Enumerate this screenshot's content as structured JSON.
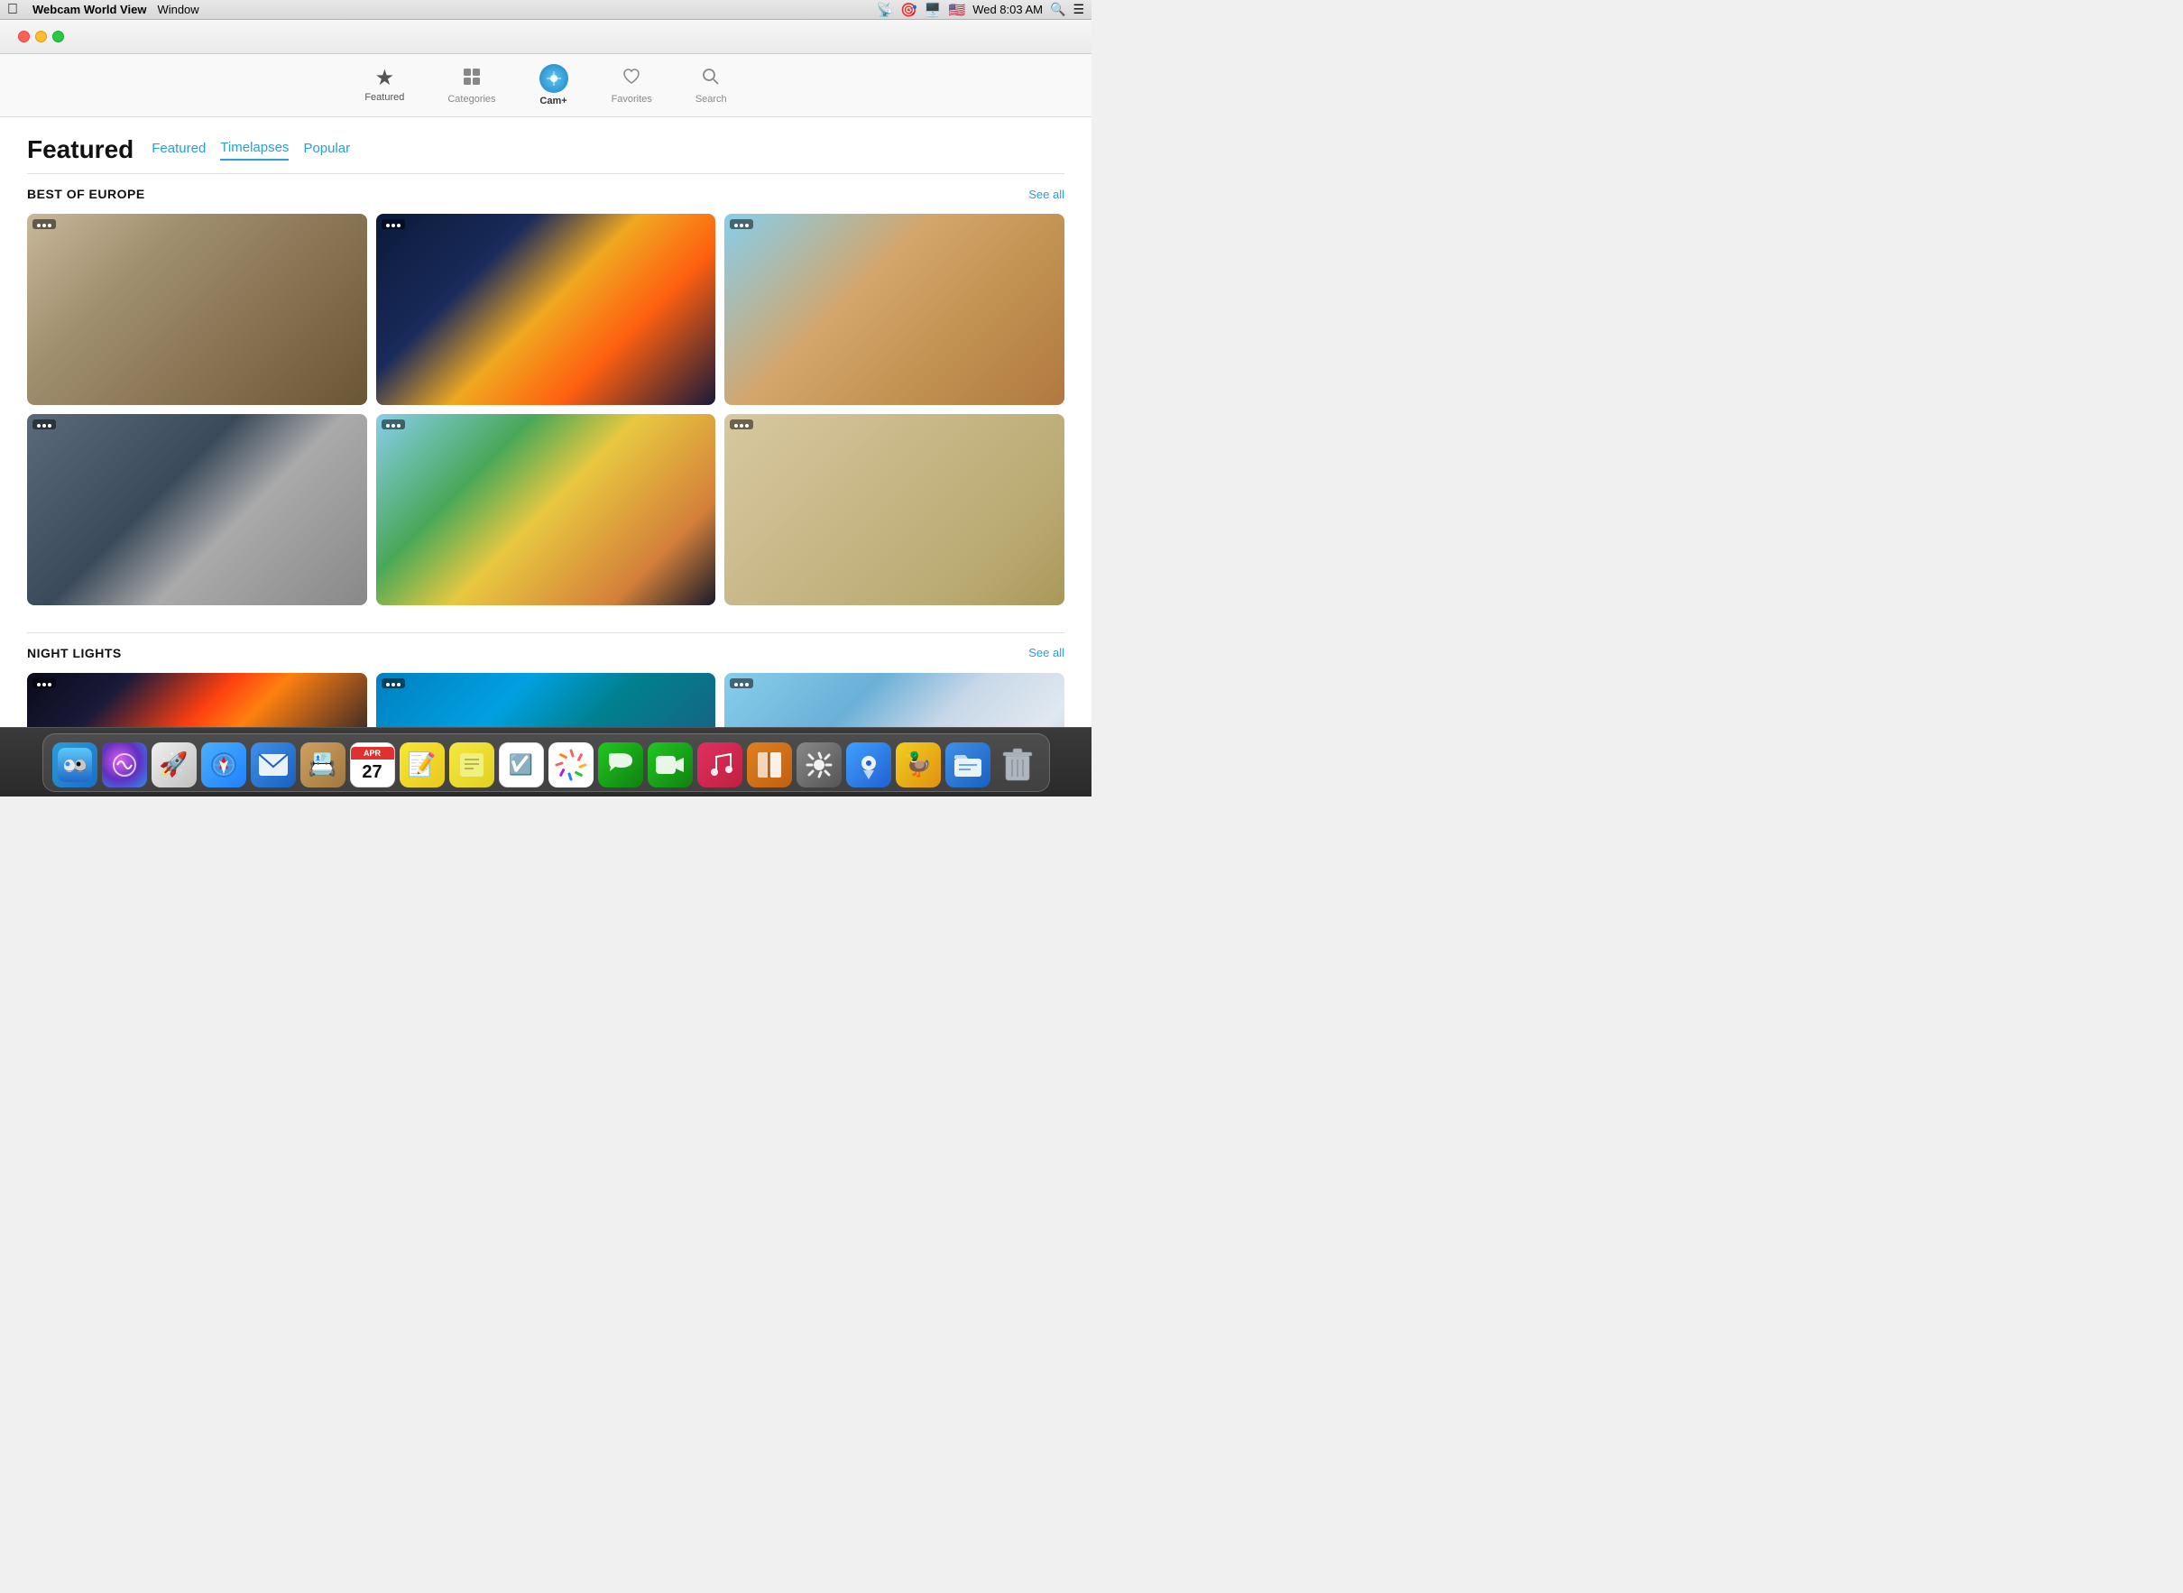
{
  "menubar": {
    "apple": "⌘",
    "app_name": "Webcam World View",
    "menu_window": "Window",
    "time": "Wed 8:03 AM"
  },
  "toolbar": {
    "items": [
      {
        "id": "featured",
        "label": "Featured",
        "icon": "★",
        "active": false
      },
      {
        "id": "categories",
        "label": "Categories",
        "icon": "⊞",
        "active": false
      },
      {
        "id": "cam_plus",
        "label": "Cam+",
        "icon": "📷",
        "active": true
      },
      {
        "id": "favorites",
        "label": "Favorites",
        "icon": "♡",
        "active": false
      },
      {
        "id": "search",
        "label": "Search",
        "icon": "🔍",
        "active": false
      }
    ]
  },
  "page": {
    "title": "Featured",
    "tabs": [
      {
        "id": "featured",
        "label": "Featured",
        "selected": false
      },
      {
        "id": "timelapses",
        "label": "Timelapses",
        "selected": true
      },
      {
        "id": "popular",
        "label": "Popular",
        "selected": false
      }
    ]
  },
  "sections": [
    {
      "id": "best_of_europe",
      "title": "BEST OF EUROPE",
      "see_all": "See all",
      "items": [
        {
          "id": "athens",
          "class": "img-athens"
        },
        {
          "id": "stpete_night",
          "class": "img-stpete-night"
        },
        {
          "id": "rome",
          "class": "img-rome"
        },
        {
          "id": "harbor",
          "class": "img-harbor"
        },
        {
          "id": "church",
          "class": "img-church"
        },
        {
          "id": "aerial",
          "class": "img-aerial"
        }
      ]
    },
    {
      "id": "night_lights",
      "title": "NIGHT LIGHTS",
      "see_all": "See all",
      "items": [
        {
          "id": "nyc",
          "class": "img-nyc"
        },
        {
          "id": "dubai",
          "class": "img-dubai"
        },
        {
          "id": "barcelona",
          "class": "img-barcelona"
        }
      ]
    }
  ],
  "dock": {
    "items": [
      {
        "id": "finder",
        "label": "Finder",
        "class": "finder",
        "icon": "🔵"
      },
      {
        "id": "siri",
        "label": "Siri",
        "class": "siri",
        "icon": "🎤"
      },
      {
        "id": "rocket",
        "label": "Rocket Typist",
        "class": "rocket",
        "icon": "🚀"
      },
      {
        "id": "safari",
        "label": "Safari",
        "class": "safari",
        "icon": "🧭"
      },
      {
        "id": "mail",
        "label": "Mail",
        "class": "mail",
        "icon": "✉️"
      },
      {
        "id": "contacts",
        "label": "Contacts",
        "class": "contacts",
        "icon": "👤"
      },
      {
        "id": "calendar",
        "label": "Calendar",
        "class": "calendar",
        "date_header": "APR",
        "date": "27"
      },
      {
        "id": "notes",
        "label": "Notes",
        "class": "notes",
        "icon": "📝"
      },
      {
        "id": "stickies",
        "label": "Stickies",
        "class": "stickies",
        "icon": "🗒️"
      },
      {
        "id": "reminders",
        "label": "Reminders",
        "class": "reminders",
        "icon": "☑️"
      },
      {
        "id": "photos",
        "label": "Photos",
        "class": "photos",
        "icon": "🌸"
      },
      {
        "id": "messages",
        "label": "Messages",
        "class": "messages",
        "icon": "💬"
      },
      {
        "id": "facetime",
        "label": "FaceTime",
        "class": "facetime",
        "icon": "📹"
      },
      {
        "id": "music",
        "label": "Music",
        "class": "music",
        "icon": "♫"
      },
      {
        "id": "books",
        "label": "Books",
        "class": "books",
        "icon": "📚"
      },
      {
        "id": "prefs",
        "label": "System Preferences",
        "class": "prefs",
        "icon": "⚙️"
      },
      {
        "id": "navi",
        "label": "Navi",
        "class": "navi",
        "icon": "🔵"
      },
      {
        "id": "adium",
        "label": "Adium",
        "class": "adium",
        "icon": "🦆"
      },
      {
        "id": "files",
        "label": "Files",
        "class": "files",
        "icon": "📁"
      },
      {
        "id": "trash",
        "label": "Trash",
        "class": "trash",
        "icon": "🗑️"
      }
    ]
  }
}
